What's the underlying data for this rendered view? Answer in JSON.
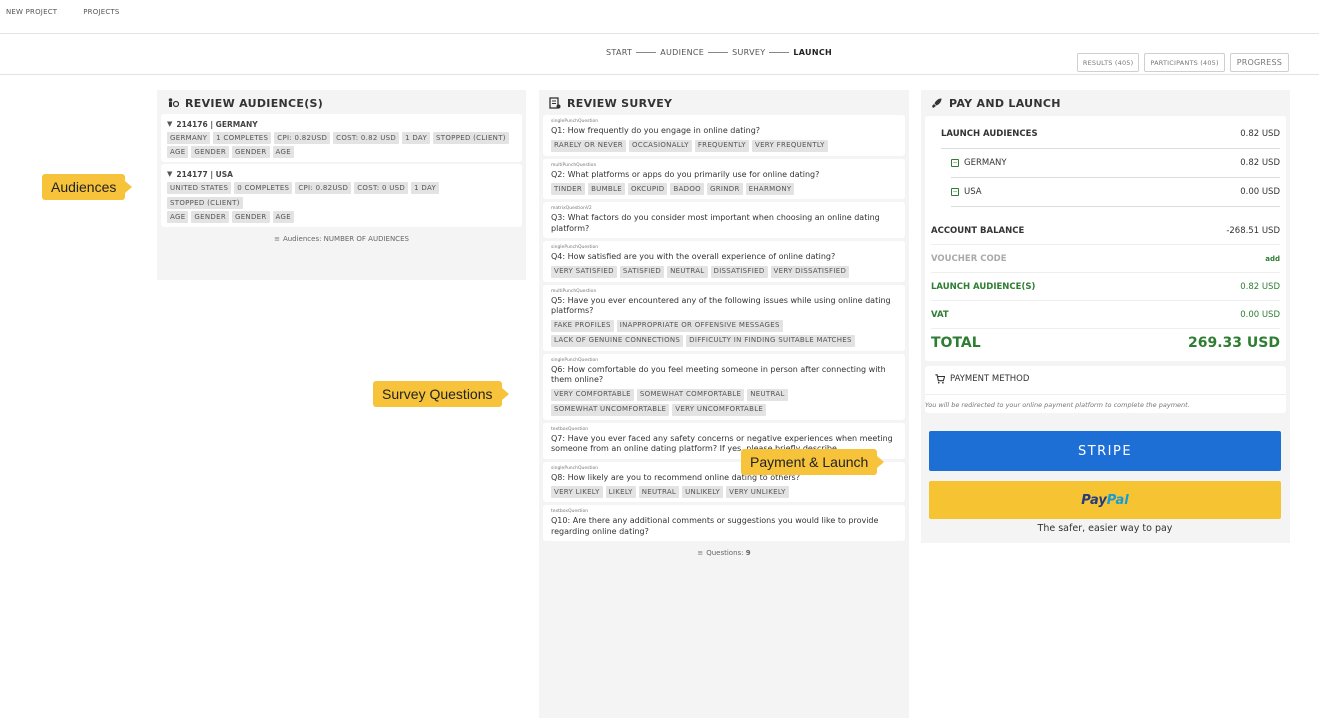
{
  "topnav": {
    "new_project": "NEW PROJECT",
    "projects": "PROJECTS"
  },
  "steps": {
    "start": "START",
    "audience": "AUDIENCE",
    "survey": "SURVEY",
    "launch": "LAUNCH"
  },
  "topbuttons": {
    "results": "RESULTS (405)",
    "participants": "PARTICIPANTS (405)",
    "progress": "PROGRESS"
  },
  "audience_panel": {
    "title": "REVIEW AUDIENCE(S)",
    "audiences": [
      {
        "header": "214176 | GERMANY",
        "stats": [
          "GERMANY",
          "1 COMPLETES",
          "CPI: 0.82USD",
          "COST: 0.82 USD",
          "1 DAY"
        ],
        "status": "STOPPED (CLIENT)",
        "quotas": [
          "AGE",
          "GENDER",
          "GENDER",
          "AGE"
        ]
      },
      {
        "header": "214177 | USA",
        "stats": [
          "UNITED STATES",
          "0 COMPLETES",
          "CPI: 0.82USD",
          "COST: 0 USD",
          "1 DAY"
        ],
        "status": "STOPPED (CLIENT)",
        "quotas": [
          "AGE",
          "GENDER",
          "GENDER",
          "AGE"
        ]
      }
    ],
    "footer": "Audiences: NUMBER OF AUDIENCES"
  },
  "survey_panel": {
    "title": "REVIEW SURVEY",
    "questions": [
      {
        "type": "singlePunchQuestion",
        "text": "Q1: How frequently do you engage in online dating?",
        "options": [
          "RARELY OR NEVER",
          "OCCASIONALLY",
          "FREQUENTLY",
          "VERY FREQUENTLY"
        ]
      },
      {
        "type": "multiPunchQuestion",
        "text": "Q2: What platforms or apps do you primarily use for online dating?",
        "options": [
          "TINDER",
          "BUMBLE",
          "OKCUPID",
          "BADOO",
          "GRINDR",
          "EHARMONY"
        ]
      },
      {
        "type": "matrixQuestionV2",
        "text": "Q3: What factors do you consider most important when choosing an online dating platform?",
        "options": []
      },
      {
        "type": "singlePunchQuestion",
        "text": "Q4: How satisfied are you with the overall experience of online dating?",
        "options": [
          "VERY SATISFIED",
          "SATISFIED",
          "NEUTRAL",
          "DISSATISFIED",
          "VERY DISSATISFIED"
        ]
      },
      {
        "type": "multiPunchQuestion",
        "text": "Q5: Have you ever encountered any of the following issues while using online dating platforms?",
        "options": [
          "FAKE PROFILES",
          "INAPPROPRIATE OR OFFENSIVE MESSAGES",
          "LACK OF GENUINE CONNECTIONS",
          "DIFFICULTY IN FINDING SUITABLE MATCHES"
        ]
      },
      {
        "type": "singlePunchQuestion",
        "text": "Q6: How comfortable do you feel meeting someone in person after connecting with them online?",
        "options": [
          "VERY COMFORTABLE",
          "SOMEWHAT COMFORTABLE",
          "NEUTRAL",
          "SOMEWHAT UNCOMFORTABLE",
          "VERY UNCOMFORTABLE"
        ]
      },
      {
        "type": "textboxQuestion",
        "text": "Q7: Have you ever faced any safety concerns or negative experiences when meeting someone from an online dating platform? If yes, please briefly describe.",
        "options": []
      },
      {
        "type": "singlePunchQuestion",
        "text": "Q8: How likely are you to recommend online dating to others?",
        "options": [
          "VERY LIKELY",
          "LIKELY",
          "NEUTRAL",
          "UNLIKELY",
          "VERY UNLIKELY"
        ]
      },
      {
        "type": "textboxQuestion",
        "text": "Q10: Are there any additional comments or suggestions you would like to provide regarding online dating?",
        "options": []
      }
    ],
    "footer_label": "Questions:",
    "footer_count": "9"
  },
  "pay_panel": {
    "title": "PAY AND LAUNCH",
    "launch_audiences_label": "LAUNCH AUDIENCES",
    "launch_audiences_value": "0.82 USD",
    "items": [
      {
        "label": "GERMANY",
        "value": "0.82 USD"
      },
      {
        "label": "USA",
        "value": "0.00 USD"
      }
    ],
    "account_balance_label": "ACCOUNT BALANCE",
    "account_balance_value": "-268.51 USD",
    "voucher_label": "VOUCHER CODE",
    "voucher_action": "add",
    "launch_aud_label": "LAUNCH AUDIENCE(S)",
    "launch_aud_value": "0.82 USD",
    "vat_label": "VAT",
    "vat_value": "0.00 USD",
    "total_label": "TOTAL",
    "total_value": "269.33 USD",
    "payment_method_label": "PAYMENT METHOD",
    "payment_note": "You will be redirected to your online payment platform to complete the payment.",
    "stripe_label": "STRIPE",
    "paypal_part1": "Pay",
    "paypal_part2": "Pal",
    "paypal_tagline": "The safer, easier way to pay"
  },
  "callouts": {
    "audiences": "Audiences",
    "survey": "Survey Questions",
    "payment": "Payment & Launch"
  },
  "colors": {
    "accent_green": "#2e7d32",
    "stripe_blue": "#1d6fd6",
    "paypal_yellow": "#f6c332",
    "callout_yellow": "#f6c33a"
  }
}
